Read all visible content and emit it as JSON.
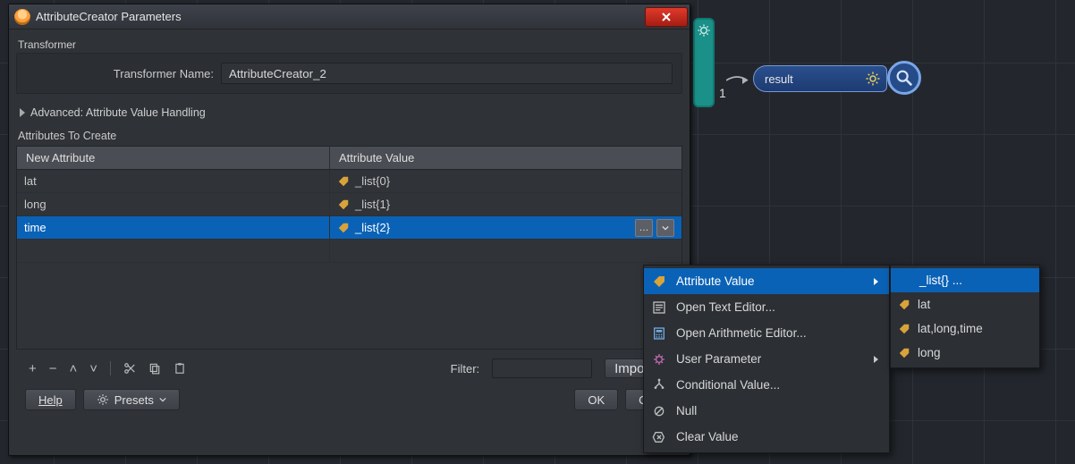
{
  "dialog": {
    "title": "AttributeCreator Parameters",
    "transformer_section_label": "Transformer",
    "transformer_name_label": "Transformer Name:",
    "transformer_name_value": "AttributeCreator_2",
    "advanced_label": "Advanced: Attribute Value Handling",
    "attrs_label": "Attributes To Create",
    "columns": {
      "name": "New Attribute",
      "value": "Attribute Value"
    },
    "rows": [
      {
        "name": "lat",
        "value": "_list{0}",
        "selected": false
      },
      {
        "name": "long",
        "value": "_list{1}",
        "selected": false
      },
      {
        "name": "time",
        "value": "_list{2}",
        "selected": true
      }
    ],
    "toolbar": {
      "add": "+",
      "remove": "−",
      "up": "˄",
      "down": "˅",
      "sep": "|",
      "cut": "✂",
      "copy": "⧉",
      "paste": "📋",
      "filter_label": "Filter:",
      "import_label": "Import ."
    },
    "footer": {
      "help": "Help",
      "presets": "Presets",
      "ok": "OK",
      "cancel": "Can"
    }
  },
  "context_menu": {
    "items": [
      {
        "key": "attr-value",
        "label": "Attribute Value",
        "icon": "tag",
        "submenu": true,
        "selected": true
      },
      {
        "key": "text-editor",
        "label": "Open Text Editor...",
        "icon": "text"
      },
      {
        "key": "arith-editor",
        "label": "Open Arithmetic Editor...",
        "icon": "calc"
      },
      {
        "key": "user-param",
        "label": "User Parameter",
        "icon": "gear",
        "submenu": true
      },
      {
        "key": "conditional",
        "label": "Conditional Value...",
        "icon": "branch"
      },
      {
        "key": "null",
        "label": "Null",
        "icon": "null"
      },
      {
        "key": "clear",
        "label": "Clear Value",
        "icon": "clear"
      }
    ]
  },
  "sub_menu": {
    "items": [
      {
        "label": "_list{} ...",
        "selected": true
      },
      {
        "label": "lat"
      },
      {
        "label": "lat,long,time"
      },
      {
        "label": "long"
      }
    ]
  },
  "canvas": {
    "port_badge": "1",
    "result_label": "result"
  }
}
